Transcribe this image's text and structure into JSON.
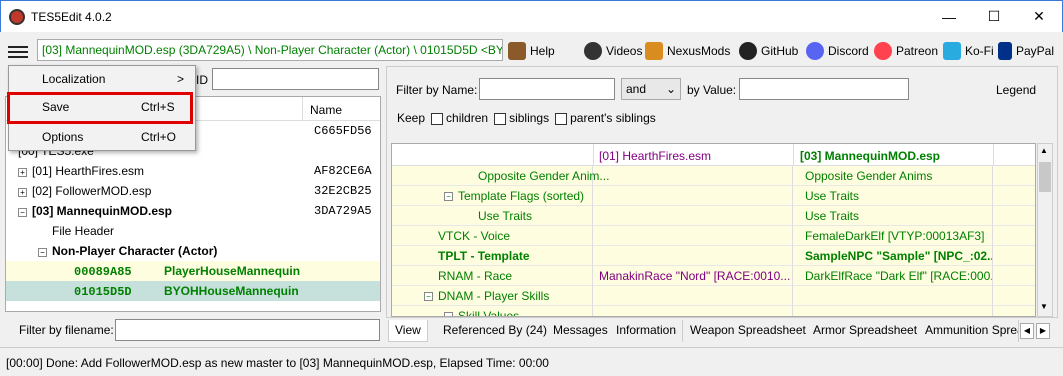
{
  "window": {
    "title": "TES5Edit 4.0.2"
  },
  "path_bar": "[03] MannequinMOD.esp (3DA729A5) \\ Non-Player Character (Actor) \\ 01015D5D <BYO",
  "toolbar_links": [
    "Help",
    "Videos",
    "NexusMods",
    "GitHub",
    "Discord",
    "Patreon",
    "Ko-Fi",
    "PayPal"
  ],
  "menu": {
    "items": [
      {
        "label": "Localization",
        "shortcut": "",
        "arrow": ">"
      },
      {
        "label": "Save",
        "shortcut": "Ctrl+S",
        "arrow": ""
      },
      {
        "label": "Options",
        "shortcut": "Ctrl+O",
        "arrow": ""
      }
    ]
  },
  "left": {
    "id_label": "ID",
    "name_header": "Name",
    "filter_by_filename": "Filter by filename:",
    "tree": [
      {
        "label": "",
        "value": "C665FD56",
        "indent": 0,
        "pm": "",
        "bold": false,
        "color": "#000",
        "bg": "#fff"
      },
      {
        "label": "[00] TES5.exe",
        "value": "",
        "indent": 0,
        "pm": "",
        "bold": false,
        "color": "#000",
        "bg": "#fff"
      },
      {
        "label": "[01] HearthFires.esm",
        "value": "AF82CE6A",
        "indent": 0,
        "pm": "+",
        "bold": false,
        "color": "#000",
        "bg": "#fff"
      },
      {
        "label": "[02] FollowerMOD.esp",
        "value": "32E2CB25",
        "indent": 0,
        "pm": "+",
        "bold": false,
        "color": "#000",
        "bg": "#fff"
      },
      {
        "label": "[03] MannequinMOD.esp",
        "value": "3DA729A5",
        "indent": 0,
        "pm": "−",
        "bold": true,
        "color": "#000",
        "bg": "#fff"
      },
      {
        "label": "File Header",
        "value": "",
        "indent": 1,
        "pm": "",
        "bold": false,
        "color": "#000",
        "bg": "#fff"
      },
      {
        "label": "Non-Player Character (Actor)",
        "value": "",
        "indent": 1,
        "pm": "−",
        "bold": true,
        "color": "#000",
        "bg": "#fff"
      },
      {
        "label": "00089A85",
        "value": "PlayerHouseMannequin",
        "indent": 2,
        "pm": "",
        "bold": true,
        "color": "#008000",
        "bg": "#fffde0"
      },
      {
        "label": "01015D5D",
        "value": "BYOHHouseMannequin",
        "indent": 2,
        "pm": "",
        "bold": true,
        "color": "#008000",
        "bg": "#c6e0dc"
      }
    ]
  },
  "right": {
    "filter_by_name": "Filter by Name:",
    "and_select": "and",
    "by_value": "by Value:",
    "legend": "Legend",
    "keep": "Keep",
    "children": "children",
    "siblings": "siblings",
    "parents_siblings": "parent's siblings",
    "col_headers": [
      "",
      "[01] HearthFires.esm",
      "[03] MannequinMOD.esp"
    ],
    "rows": [
      {
        "c0": "Opposite Gender Anim...",
        "c1": "",
        "c2": "Opposite Gender Anims",
        "indent": 3,
        "pm": "",
        "bold": false
      },
      {
        "c0": "Template Flags (sorted)",
        "c1": "",
        "c2": "Use Traits",
        "indent": 2,
        "pm": "−",
        "bold": false
      },
      {
        "c0": "Use Traits",
        "c1": "",
        "c2": "Use Traits",
        "indent": 3,
        "pm": "",
        "bold": false
      },
      {
        "c0": "VTCK - Voice",
        "c1": "",
        "c2": "FemaleDarkElf [VTYP:00013AF3]",
        "indent": 1,
        "pm": "",
        "bold": false
      },
      {
        "c0": "TPLT - Template",
        "c1": "",
        "c2": "SampleNPC \"Sample\" [NPC_:02...",
        "indent": 1,
        "pm": "",
        "bold": true
      },
      {
        "c0": "RNAM - Race",
        "c1": "ManakinRace \"Nord\" [RACE:0010...",
        "c2": "DarkElfRace \"Dark Elf\" [RACE:000...",
        "indent": 1,
        "pm": "",
        "bold": false
      },
      {
        "c0": "DNAM - Player Skills",
        "c1": "",
        "c2": "",
        "indent": 1,
        "pm": "−",
        "bold": false
      },
      {
        "c0": "Skill Values",
        "c1": "",
        "c2": "",
        "indent": 2,
        "pm": "−",
        "bold": false
      }
    ],
    "tabs": [
      "View",
      "Referenced By (24)",
      "Messages",
      "Information",
      "Weapon Spreadsheet",
      "Armor Spreadsheet",
      "Ammunition Sprea"
    ]
  },
  "status": "[00:00] Done: Add FollowerMOD.esp as new master to [03] MannequinMOD.esp, Elapsed Time: 00:00"
}
